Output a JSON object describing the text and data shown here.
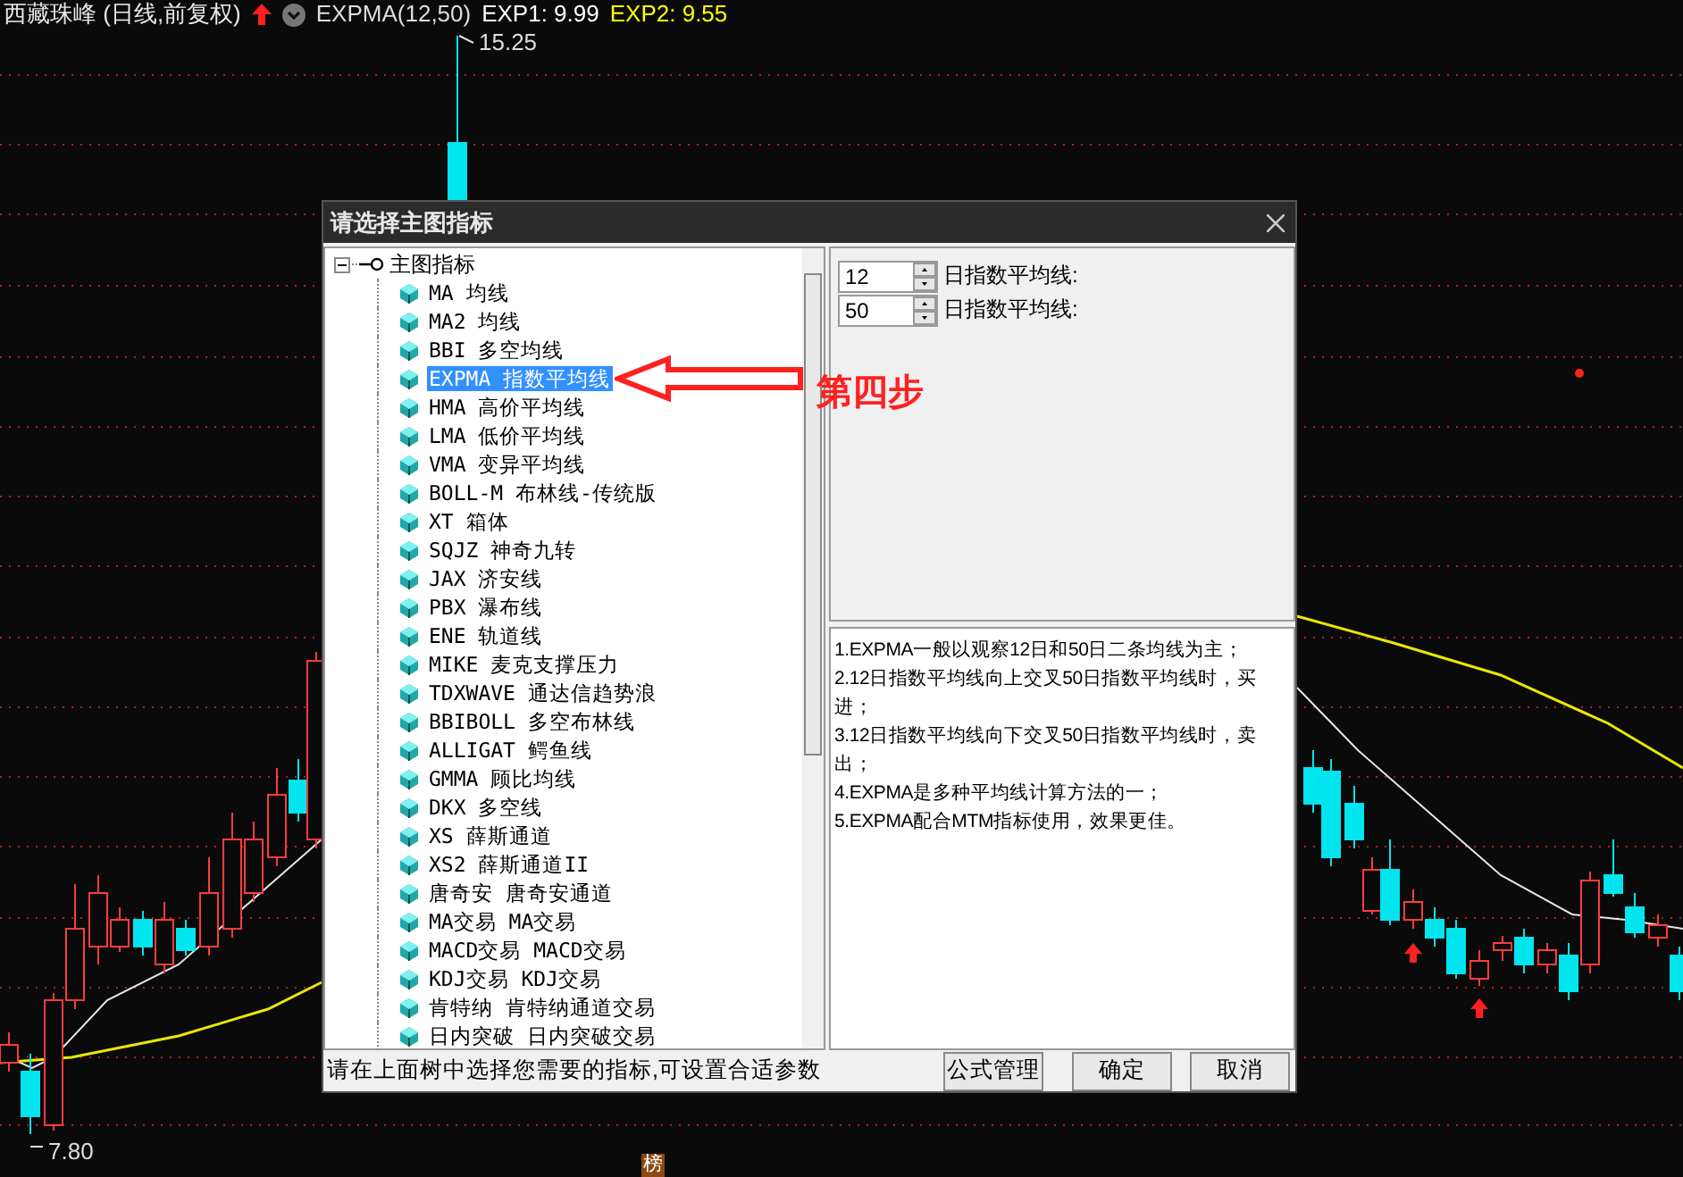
{
  "header": {
    "stock": "西藏珠峰 (日线,前复权)",
    "indicator": "EXPMA(12,50)",
    "values": [
      {
        "text": "EXP1: 9.99",
        "color": "#ffffff"
      },
      {
        "text": "EXP2: 9.55",
        "color": "#ffff00"
      }
    ]
  },
  "chart": {
    "high_label": "15.25",
    "low_label": "7.80",
    "badge": "榜"
  },
  "dialog": {
    "title": "请选择主图指标",
    "tree": {
      "label": "主图指标",
      "expanded": true,
      "children": [
        {
          "label": "MA 均线",
          "selected": false
        },
        {
          "label": "MA2 均线",
          "selected": false
        },
        {
          "label": "BBI 多空均线",
          "selected": false
        },
        {
          "label": "EXPMA 指数平均线",
          "selected": true
        },
        {
          "label": "HMA 高价平均线",
          "selected": false
        },
        {
          "label": "LMA 低价平均线",
          "selected": false
        },
        {
          "label": "VMA 变异平均线",
          "selected": false
        },
        {
          "label": "BOLL-M 布林线-传统版",
          "selected": false
        },
        {
          "label": "XT 箱体",
          "selected": false
        },
        {
          "label": "SQJZ 神奇九转",
          "selected": false
        },
        {
          "label": "JAX 济安线",
          "selected": false
        },
        {
          "label": "PBX 瀑布线",
          "selected": false
        },
        {
          "label": "ENE 轨道线",
          "selected": false
        },
        {
          "label": "MIKE 麦克支撑压力",
          "selected": false
        },
        {
          "label": "TDXWAVE 通达信趋势浪",
          "selected": false
        },
        {
          "label": "BBIBOLL 多空布林线",
          "selected": false
        },
        {
          "label": "ALLIGAT 鳄鱼线",
          "selected": false
        },
        {
          "label": "GMMA 顾比均线",
          "selected": false
        },
        {
          "label": "DKX 多空线",
          "selected": false
        },
        {
          "label": "XS 薛斯通道",
          "selected": false
        },
        {
          "label": "XS2 薛斯通道II",
          "selected": false
        },
        {
          "label": "唐奇安 唐奇安通道",
          "selected": false
        },
        {
          "label": "MA交易 MA交易",
          "selected": false
        },
        {
          "label": "MACD交易 MACD交易",
          "selected": false
        },
        {
          "label": "KDJ交易 KDJ交易",
          "selected": false
        },
        {
          "label": "肯特纳 肯特纳通道交易",
          "selected": false
        },
        {
          "label": "日内突破 日内突破交易",
          "selected": false
        }
      ]
    },
    "params": [
      {
        "value": "12",
        "label": "日指数平均线:"
      },
      {
        "value": "50",
        "label": "日指数平均线:"
      }
    ],
    "description": [
      "1.EXPMA一般以观察12日和50日二条均线为主；",
      "2.12日指数平均线向上交叉50日指数平均线时，买进；",
      "3.12日指数平均线向下交叉50日指数平均线时，卖出；",
      "4.EXPMA是多种平均线计算方法的一；",
      "5.EXPMA配合MTM指标使用，效果更佳。"
    ],
    "hint": "请在上面树中选择您需要的指标,可设置合适参数",
    "buttons": [
      "公式管理",
      "确定",
      "取消"
    ]
  },
  "annotation": "第四步"
}
